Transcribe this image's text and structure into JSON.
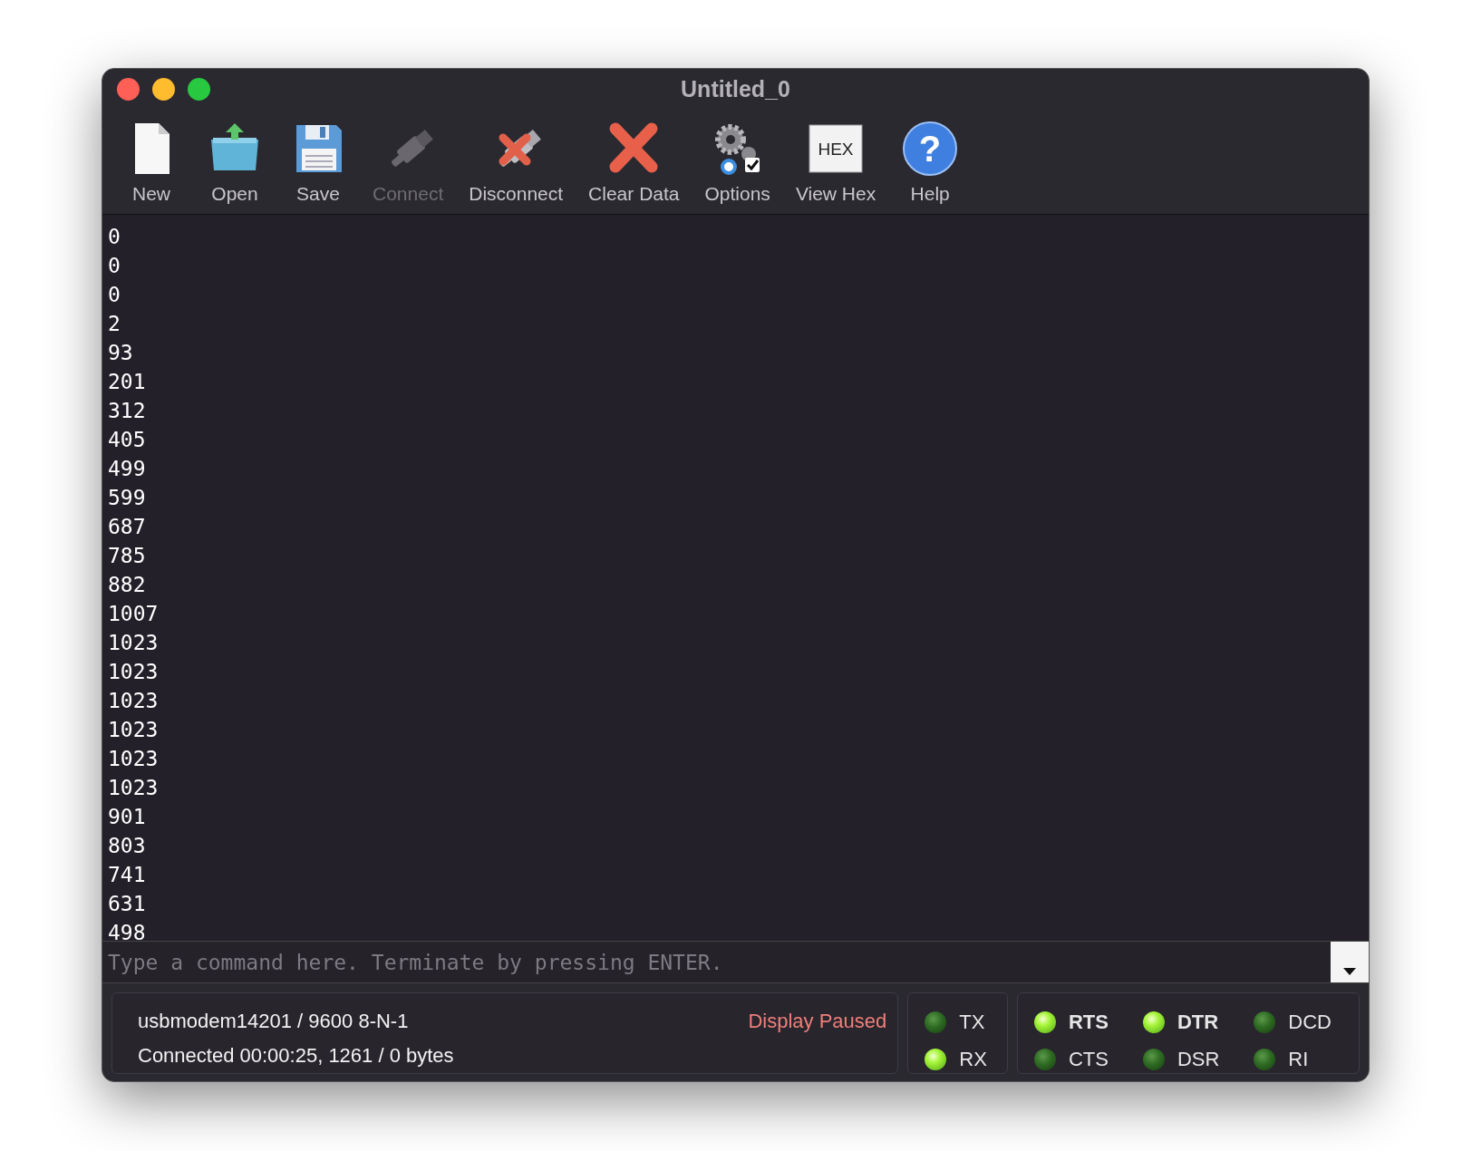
{
  "window": {
    "title": "Untitled_0"
  },
  "toolbar": [
    {
      "label": "New",
      "disabled": false
    },
    {
      "label": "Open",
      "disabled": false
    },
    {
      "label": "Save",
      "disabled": false
    },
    {
      "label": "Connect",
      "disabled": true
    },
    {
      "label": "Disconnect",
      "disabled": false
    },
    {
      "label": "Clear Data",
      "disabled": false
    },
    {
      "label": "Options",
      "disabled": false
    },
    {
      "label": "View Hex",
      "disabled": false,
      "icon_text": "HEX"
    },
    {
      "label": "Help",
      "disabled": false,
      "icon_text": "?"
    }
  ],
  "terminal": {
    "lines": [
      "0",
      "0",
      "0",
      "2",
      "93",
      "201",
      "312",
      "405",
      "499",
      "599",
      "687",
      "785",
      "882",
      "1007",
      "1023",
      "1023",
      "1023",
      "1023",
      "1023",
      "1023",
      "901",
      "803",
      "741",
      "631",
      "498"
    ]
  },
  "command": {
    "placeholder": "Type a command here. Terminate by pressing ENTER."
  },
  "status": {
    "port": "usbmodem14201 / 9600 8-N-1",
    "connection": "Connected 00:00:25, 1261 / 0 bytes",
    "notice": "Display Paused"
  },
  "activity": [
    {
      "label": "TX",
      "on": false
    },
    {
      "label": "RX",
      "on": true
    }
  ],
  "signals": [
    {
      "label": "RTS",
      "on": true,
      "kind": "output"
    },
    {
      "label": "DTR",
      "on": true,
      "kind": "output"
    },
    {
      "label": "DCD",
      "on": false,
      "kind": "input"
    },
    {
      "label": "CTS",
      "on": false,
      "kind": "input"
    },
    {
      "label": "DSR",
      "on": false,
      "kind": "input"
    },
    {
      "label": "RI",
      "on": false,
      "kind": "input"
    }
  ]
}
